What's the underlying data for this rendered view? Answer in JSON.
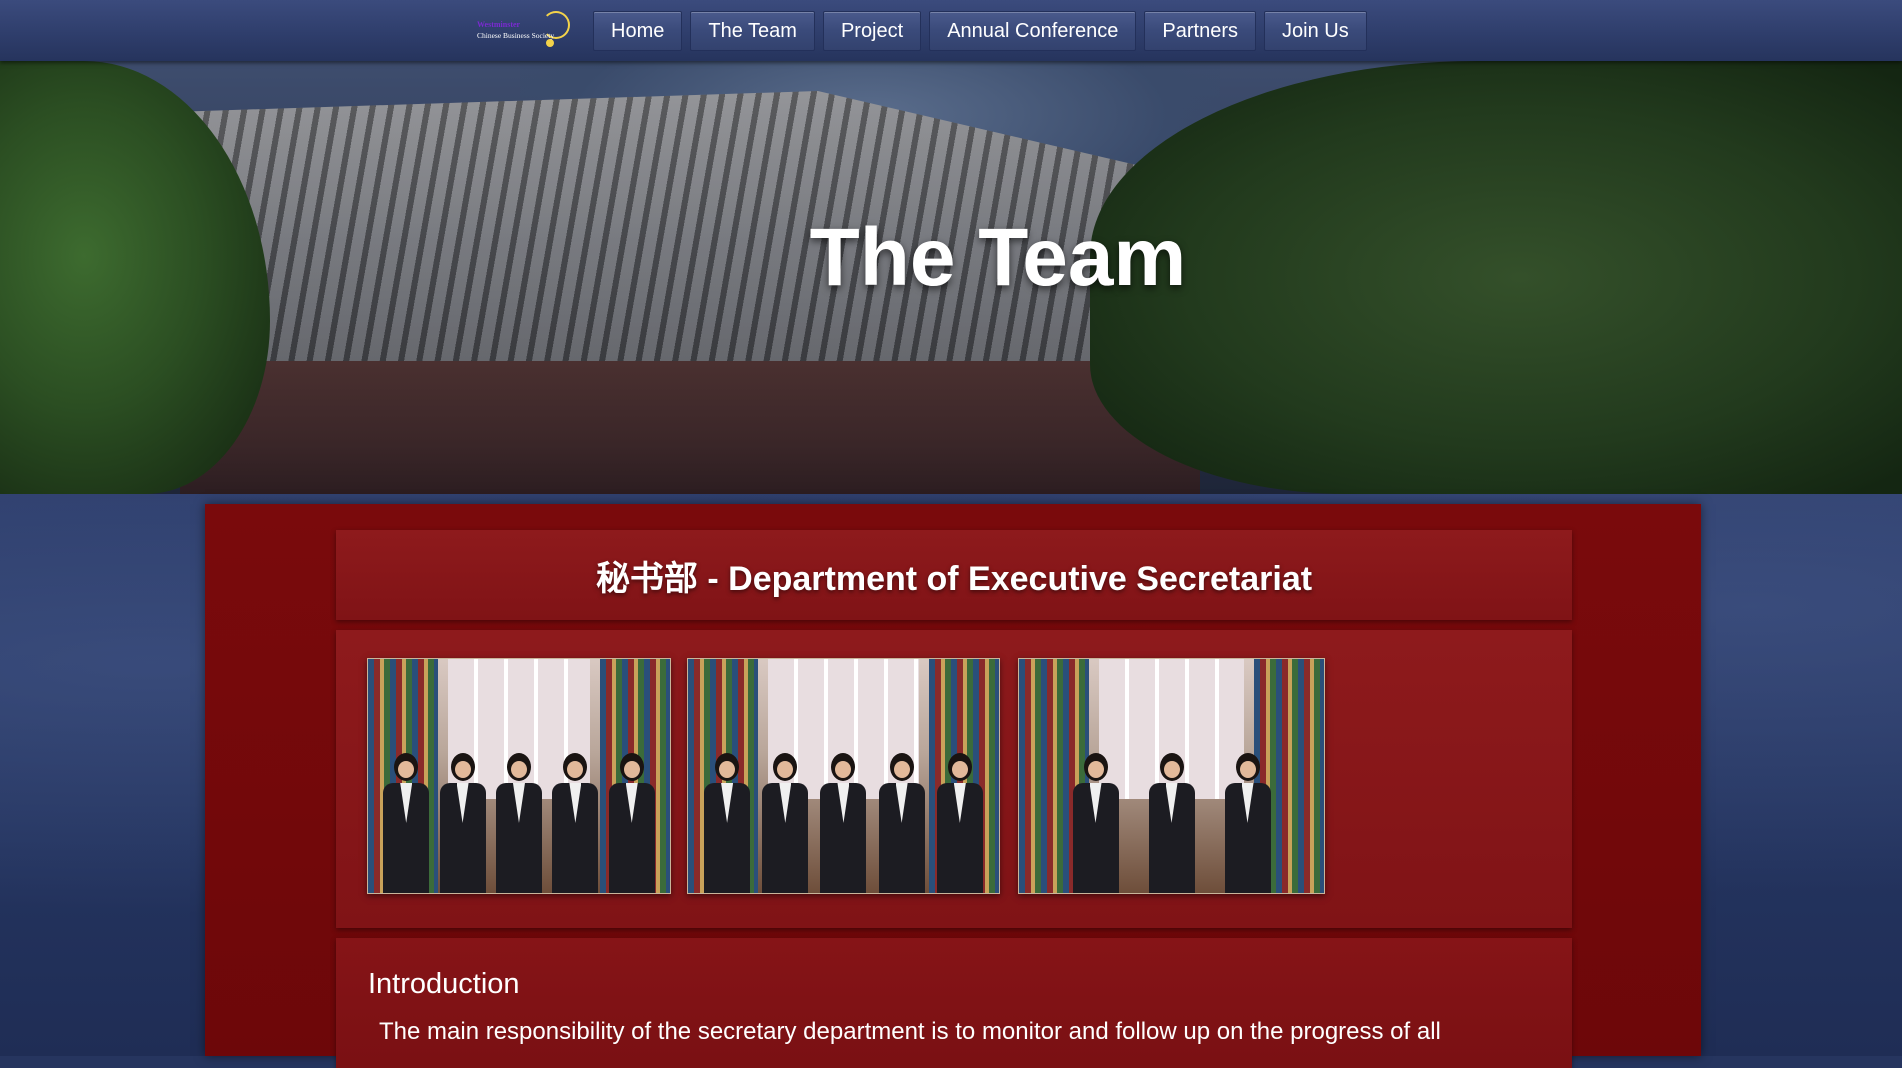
{
  "logo": {
    "line1": "Westminster",
    "line2": "Chinese Business Society",
    "accent_color": "#f4d34a"
  },
  "nav": {
    "items": [
      "Home",
      "The Team",
      "Project",
      "Annual Conference",
      "Partners",
      "Join Us"
    ]
  },
  "hero": {
    "title": "The Team"
  },
  "section": {
    "title": "秘书部 - Department of Executive Secretariat"
  },
  "gallery": {
    "photos": [
      "team-photo-1",
      "team-photo-2",
      "team-photo-3"
    ]
  },
  "intro": {
    "heading": "Introduction",
    "text": "The main responsibility of the secretary department is to monitor and follow up on the progress of all"
  },
  "colors": {
    "panel_red": "#7a0a0c",
    "nav_blue": "#3a4a7a",
    "page_blue": "#26355f"
  }
}
